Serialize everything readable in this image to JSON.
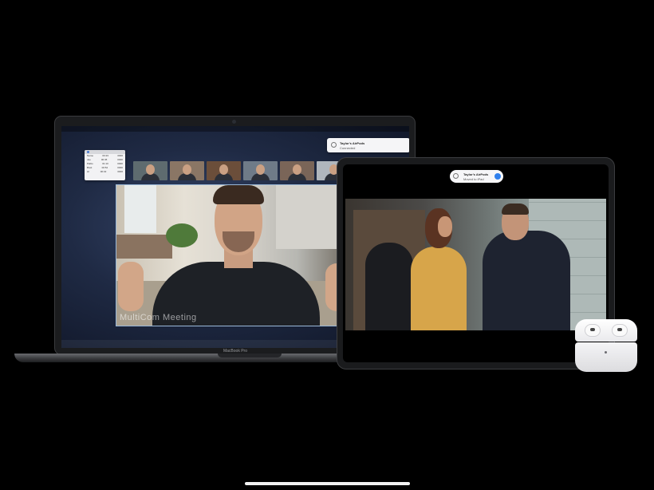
{
  "macbook": {
    "label": "MacBook Pro",
    "app_name": "MultiCom Meeting",
    "airpods_toast": {
      "title": "Taylor's AirPods",
      "subtitle": "Connected"
    },
    "mini_window_rows": [
      [
        "Name",
        "00:23",
        "0000"
      ],
      [
        "Joe",
        "00:45",
        "0000"
      ],
      [
        "Pablo",
        "01:10",
        "0000"
      ],
      [
        "Brett",
        "00:54",
        "0000"
      ],
      [
        "Al",
        "00:32",
        "0000"
      ]
    ],
    "participant_thumbnails": [
      {
        "bg": "#5e6b6f"
      },
      {
        "bg": "#8a7665"
      },
      {
        "bg": "#6b4e3a"
      },
      {
        "bg": "#6f7b88"
      },
      {
        "bg": "#7a6558"
      },
      {
        "bg": "#b0b6bd"
      }
    ]
  },
  "ipad": {
    "airpods_toast": {
      "title": "Taylor's AirPods",
      "subtitle": "Moved to iPad"
    }
  },
  "colors": {
    "background": "#000000",
    "accent": "#2f80ed",
    "frame_border": "#9ab8d8"
  }
}
